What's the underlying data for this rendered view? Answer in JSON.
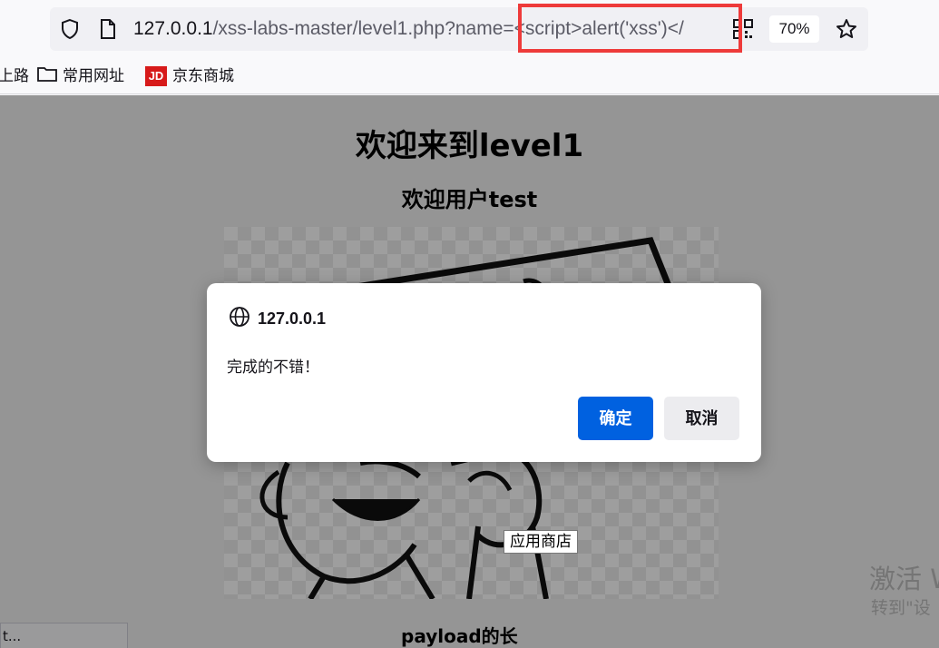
{
  "browser": {
    "url_host": "127.0.0.1",
    "url_path": "/xss-labs-master/level1.php?name=<script>alert('xss')</",
    "zoom": "70%",
    "icons": [
      "shield-icon",
      "page-icon",
      "qr-code-icon",
      "star-icon"
    ]
  },
  "bookmarks": [
    {
      "label": "上路",
      "icon": "none"
    },
    {
      "label": "常用网址",
      "icon": "folder-icon"
    },
    {
      "label": "京东商城",
      "icon": "jd-logo"
    }
  ],
  "page": {
    "heading": "欢迎来到level1",
    "subheading": "欢迎用户test",
    "payload_label": "payload的长",
    "status_text": "t...",
    "watermark_line1": "激活 W",
    "watermark_line2": "转到\"设"
  },
  "tooltip": "应用商店",
  "dialog": {
    "origin": "127.0.0.1",
    "message": "完成的不错！",
    "ok_label": "确定",
    "cancel_label": "取消"
  },
  "colors": {
    "accent": "#0061e0",
    "highlight_box": "#ee3a3a"
  }
}
